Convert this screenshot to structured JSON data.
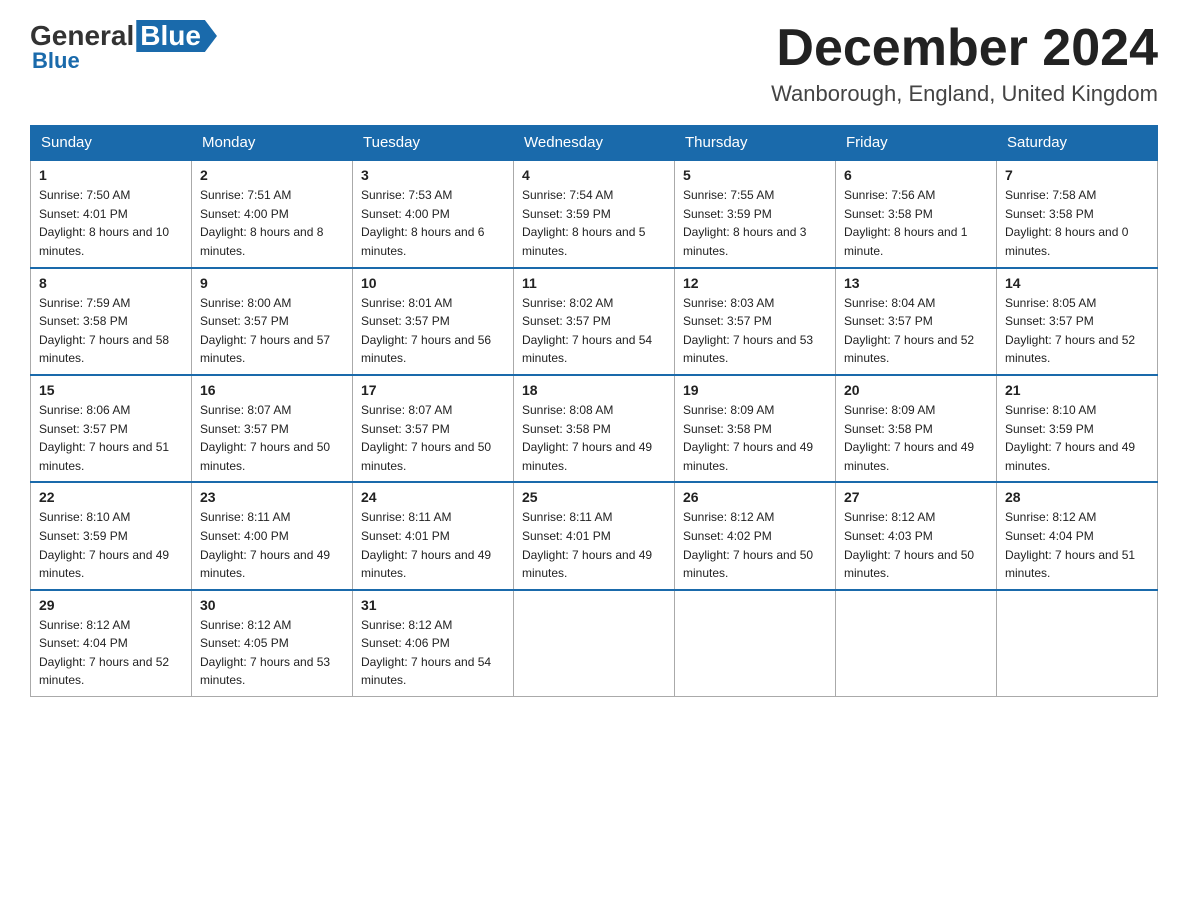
{
  "logo": {
    "general": "General",
    "blue": "Blue"
  },
  "header": {
    "month": "December 2024",
    "location": "Wanborough, England, United Kingdom"
  },
  "days_of_week": [
    "Sunday",
    "Monday",
    "Tuesday",
    "Wednesday",
    "Thursday",
    "Friday",
    "Saturday"
  ],
  "weeks": [
    [
      {
        "day": "1",
        "sunrise": "7:50 AM",
        "sunset": "4:01 PM",
        "daylight": "8 hours and 10 minutes."
      },
      {
        "day": "2",
        "sunrise": "7:51 AM",
        "sunset": "4:00 PM",
        "daylight": "8 hours and 8 minutes."
      },
      {
        "day": "3",
        "sunrise": "7:53 AM",
        "sunset": "4:00 PM",
        "daylight": "8 hours and 6 minutes."
      },
      {
        "day": "4",
        "sunrise": "7:54 AM",
        "sunset": "3:59 PM",
        "daylight": "8 hours and 5 minutes."
      },
      {
        "day": "5",
        "sunrise": "7:55 AM",
        "sunset": "3:59 PM",
        "daylight": "8 hours and 3 minutes."
      },
      {
        "day": "6",
        "sunrise": "7:56 AM",
        "sunset": "3:58 PM",
        "daylight": "8 hours and 1 minute."
      },
      {
        "day": "7",
        "sunrise": "7:58 AM",
        "sunset": "3:58 PM",
        "daylight": "8 hours and 0 minutes."
      }
    ],
    [
      {
        "day": "8",
        "sunrise": "7:59 AM",
        "sunset": "3:58 PM",
        "daylight": "7 hours and 58 minutes."
      },
      {
        "day": "9",
        "sunrise": "8:00 AM",
        "sunset": "3:57 PM",
        "daylight": "7 hours and 57 minutes."
      },
      {
        "day": "10",
        "sunrise": "8:01 AM",
        "sunset": "3:57 PM",
        "daylight": "7 hours and 56 minutes."
      },
      {
        "day": "11",
        "sunrise": "8:02 AM",
        "sunset": "3:57 PM",
        "daylight": "7 hours and 54 minutes."
      },
      {
        "day": "12",
        "sunrise": "8:03 AM",
        "sunset": "3:57 PM",
        "daylight": "7 hours and 53 minutes."
      },
      {
        "day": "13",
        "sunrise": "8:04 AM",
        "sunset": "3:57 PM",
        "daylight": "7 hours and 52 minutes."
      },
      {
        "day": "14",
        "sunrise": "8:05 AM",
        "sunset": "3:57 PM",
        "daylight": "7 hours and 52 minutes."
      }
    ],
    [
      {
        "day": "15",
        "sunrise": "8:06 AM",
        "sunset": "3:57 PM",
        "daylight": "7 hours and 51 minutes."
      },
      {
        "day": "16",
        "sunrise": "8:07 AM",
        "sunset": "3:57 PM",
        "daylight": "7 hours and 50 minutes."
      },
      {
        "day": "17",
        "sunrise": "8:07 AM",
        "sunset": "3:57 PM",
        "daylight": "7 hours and 50 minutes."
      },
      {
        "day": "18",
        "sunrise": "8:08 AM",
        "sunset": "3:58 PM",
        "daylight": "7 hours and 49 minutes."
      },
      {
        "day": "19",
        "sunrise": "8:09 AM",
        "sunset": "3:58 PM",
        "daylight": "7 hours and 49 minutes."
      },
      {
        "day": "20",
        "sunrise": "8:09 AM",
        "sunset": "3:58 PM",
        "daylight": "7 hours and 49 minutes."
      },
      {
        "day": "21",
        "sunrise": "8:10 AM",
        "sunset": "3:59 PM",
        "daylight": "7 hours and 49 minutes."
      }
    ],
    [
      {
        "day": "22",
        "sunrise": "8:10 AM",
        "sunset": "3:59 PM",
        "daylight": "7 hours and 49 minutes."
      },
      {
        "day": "23",
        "sunrise": "8:11 AM",
        "sunset": "4:00 PM",
        "daylight": "7 hours and 49 minutes."
      },
      {
        "day": "24",
        "sunrise": "8:11 AM",
        "sunset": "4:01 PM",
        "daylight": "7 hours and 49 minutes."
      },
      {
        "day": "25",
        "sunrise": "8:11 AM",
        "sunset": "4:01 PM",
        "daylight": "7 hours and 49 minutes."
      },
      {
        "day": "26",
        "sunrise": "8:12 AM",
        "sunset": "4:02 PM",
        "daylight": "7 hours and 50 minutes."
      },
      {
        "day": "27",
        "sunrise": "8:12 AM",
        "sunset": "4:03 PM",
        "daylight": "7 hours and 50 minutes."
      },
      {
        "day": "28",
        "sunrise": "8:12 AM",
        "sunset": "4:04 PM",
        "daylight": "7 hours and 51 minutes."
      }
    ],
    [
      {
        "day": "29",
        "sunrise": "8:12 AM",
        "sunset": "4:04 PM",
        "daylight": "7 hours and 52 minutes."
      },
      {
        "day": "30",
        "sunrise": "8:12 AM",
        "sunset": "4:05 PM",
        "daylight": "7 hours and 53 minutes."
      },
      {
        "day": "31",
        "sunrise": "8:12 AM",
        "sunset": "4:06 PM",
        "daylight": "7 hours and 54 minutes."
      },
      null,
      null,
      null,
      null
    ]
  ],
  "labels": {
    "sunrise": "Sunrise:",
    "sunset": "Sunset:",
    "daylight": "Daylight:"
  }
}
